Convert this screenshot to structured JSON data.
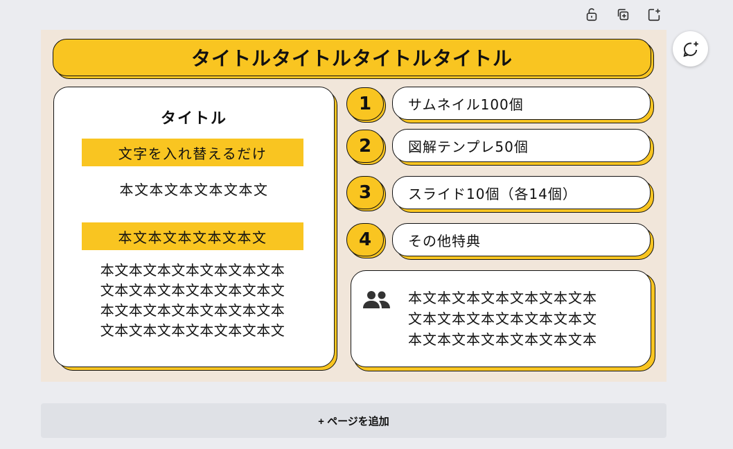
{
  "toolbar": {
    "lock_icon": "lock-open-icon",
    "duplicate_icon": "duplicate-icon",
    "add_icon": "add-page-icon"
  },
  "slide": {
    "title": "タイトルタイトルタイトルタイトル",
    "left_card": {
      "heading": "タイトル",
      "band1": "文字を入れ替えるだけ",
      "line1": "本文本文本文本文本文",
      "band2": "本文本文本文本文本文",
      "paragraph": [
        "本文本文本文本文本文本文本",
        "文本文本文本文本文本文本文",
        "本文本文本文本文本文本文本",
        "文本文本文本文本文本文本文"
      ]
    },
    "items": [
      {
        "number": "1",
        "label": "サムネイル100個"
      },
      {
        "number": "2",
        "label": "図解テンプレ50個"
      },
      {
        "number": "3",
        "label": "スライド10個（各14個）"
      },
      {
        "number": "4",
        "label": "その他特典"
      }
    ],
    "bottom_card": {
      "icon": "people-icon",
      "paragraph": [
        "本文本文本文本文本文本文本",
        "文本文本文本文本文本文本文",
        "本文本文本文本文本文本文本"
      ]
    }
  },
  "colors": {
    "accent_yellow": "#f9c521",
    "slide_background": "#f1e6da",
    "canvas_background": "#ebecf0"
  },
  "add_page": {
    "label": "+ ページを追加"
  }
}
